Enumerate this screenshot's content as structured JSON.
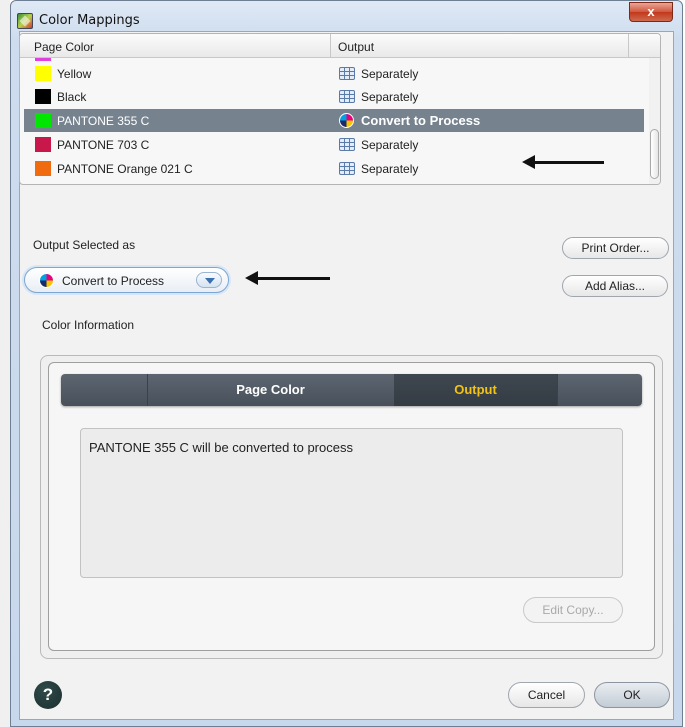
{
  "window": {
    "title": "Color Mappings",
    "close_symbol": "x"
  },
  "table": {
    "columns": [
      "Page Color",
      "Output"
    ],
    "rows": [
      {
        "page_color": "Yellow",
        "swatch": "#ffff00",
        "output": "Separately",
        "output_icon": "separately-icon",
        "selected": false
      },
      {
        "page_color": "Black",
        "swatch": "#000000",
        "output": "Separately",
        "output_icon": "separately-icon",
        "selected": false
      },
      {
        "page_color": "PANTONE 355 C",
        "swatch": "#00e600",
        "output": "Convert to Process",
        "output_icon": "process-icon",
        "selected": true
      },
      {
        "page_color": "PANTONE 703 C",
        "swatch": "#c8174a",
        "output": "Separately",
        "output_icon": "separately-icon",
        "selected": false
      },
      {
        "page_color": "PANTONE Orange 021 C",
        "swatch": "#f06a10",
        "output": "Separately",
        "output_icon": "separately-icon",
        "selected": false
      }
    ],
    "partial_top_swatch": "#e040e0"
  },
  "output_selected": {
    "label": "Output Selected as",
    "value": "Convert to Process"
  },
  "buttons": {
    "print_order": "Print Order...",
    "add_alias": "Add Alias...",
    "edit_copy": "Edit Copy...",
    "cancel": "Cancel",
    "ok": "OK",
    "help": "?"
  },
  "color_info": {
    "label": "Color Information",
    "tabs": [
      "Page Color",
      "Output"
    ],
    "active_tab": "Output",
    "message": "PANTONE 355 C will be converted to process"
  },
  "colors": {
    "selected_row": "#76838f",
    "active_tab_text": "#f3c313"
  }
}
